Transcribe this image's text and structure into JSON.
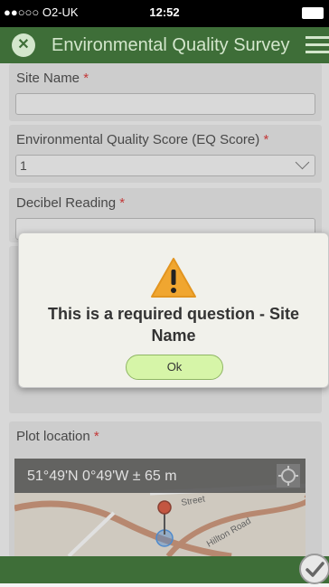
{
  "status_bar": {
    "carrier": "●●○○○ O2-UK",
    "time": "12:52"
  },
  "header": {
    "title": "Environmental Quality Survey"
  },
  "form": {
    "site_name": {
      "label": "Site Name",
      "required_mark": "*",
      "value": ""
    },
    "eq_score": {
      "label": "Environmental Quality Score (EQ Score)",
      "required_mark": "*",
      "selected": "1"
    },
    "decibel": {
      "label": "Decibel Reading",
      "required_mark": "*",
      "value": ""
    },
    "plot_location": {
      "label": "Plot location",
      "required_mark": "*",
      "coordinates": "51°49'N 0°49'W ± 65 m",
      "map_labels": [
        "Street",
        "Hillton Road"
      ]
    }
  },
  "dialog": {
    "message": "This is a required question - Site Name",
    "ok_label": "Ok"
  },
  "colors": {
    "brand": "#3e6e38",
    "accent": "#d6f5a8",
    "required": "#d92020"
  }
}
